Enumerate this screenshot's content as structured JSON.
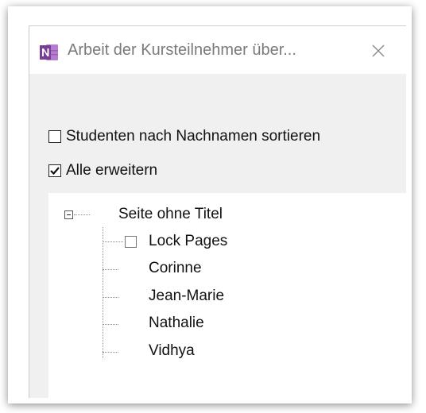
{
  "dialog": {
    "title": "Arbeit der Kursteilnehmer über...",
    "app_icon": "onenote-icon",
    "close_icon": "close-icon",
    "accent_color": "#7b3e96"
  },
  "options": {
    "sort_by_lastname": {
      "label": "Studenten nach Nachnamen sortieren",
      "checked": false
    },
    "expand_all": {
      "label": "Alle erweitern",
      "checked": true
    }
  },
  "tree": {
    "root_label": "Seite ohne Titel",
    "expanded": true,
    "lock_pages": {
      "label": "Lock Pages",
      "checked": false
    },
    "students": [
      "Corinne",
      "Jean-Marie",
      "Nathalie",
      "Vidhya"
    ]
  }
}
